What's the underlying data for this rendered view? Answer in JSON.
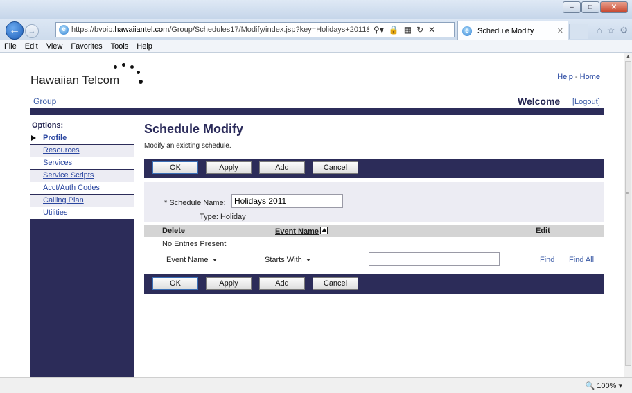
{
  "browser": {
    "url_prefix": "https://bvoip.",
    "url_domain": "hawaiiantel.com",
    "url_rest": "/Group/Schedules17/Modify/index.jsp?key=Holidays+2011&nar",
    "tab_title": "Schedule Modify",
    "zoom": "100%",
    "menu": [
      "File",
      "Edit",
      "View",
      "Favorites",
      "Tools",
      "Help"
    ]
  },
  "header": {
    "logo_text": "Hawaiian Telcom",
    "help_link": "Help",
    "separator": "-",
    "home_link": "Home",
    "group_link": "Group",
    "welcome": "Welcome",
    "logout": "[Logout]"
  },
  "sidebar": {
    "heading": "Options:",
    "items": [
      {
        "label": "Profile"
      },
      {
        "label": "Resources"
      },
      {
        "label": "Services"
      },
      {
        "label": "Service Scripts"
      },
      {
        "label": "Acct/Auth Codes"
      },
      {
        "label": "Calling Plan"
      },
      {
        "label": "Utilities"
      }
    ]
  },
  "main": {
    "title": "Schedule Modify",
    "description": "Modify an existing schedule.",
    "buttons": {
      "ok": "OK",
      "apply": "Apply",
      "add": "Add",
      "cancel": "Cancel"
    },
    "form": {
      "schedule_name_label": "* Schedule Name:",
      "schedule_name_value": "Holidays 2011",
      "type_label": "Type: Holiday"
    },
    "table": {
      "columns": {
        "delete": "Delete",
        "event_name": "Event Name",
        "edit": "Edit"
      },
      "empty_text": "No Entries Present"
    },
    "search": {
      "field_select": "Event Name",
      "mode_select": "Starts With",
      "input_value": "",
      "find": "Find",
      "find_all": "Find All"
    }
  }
}
